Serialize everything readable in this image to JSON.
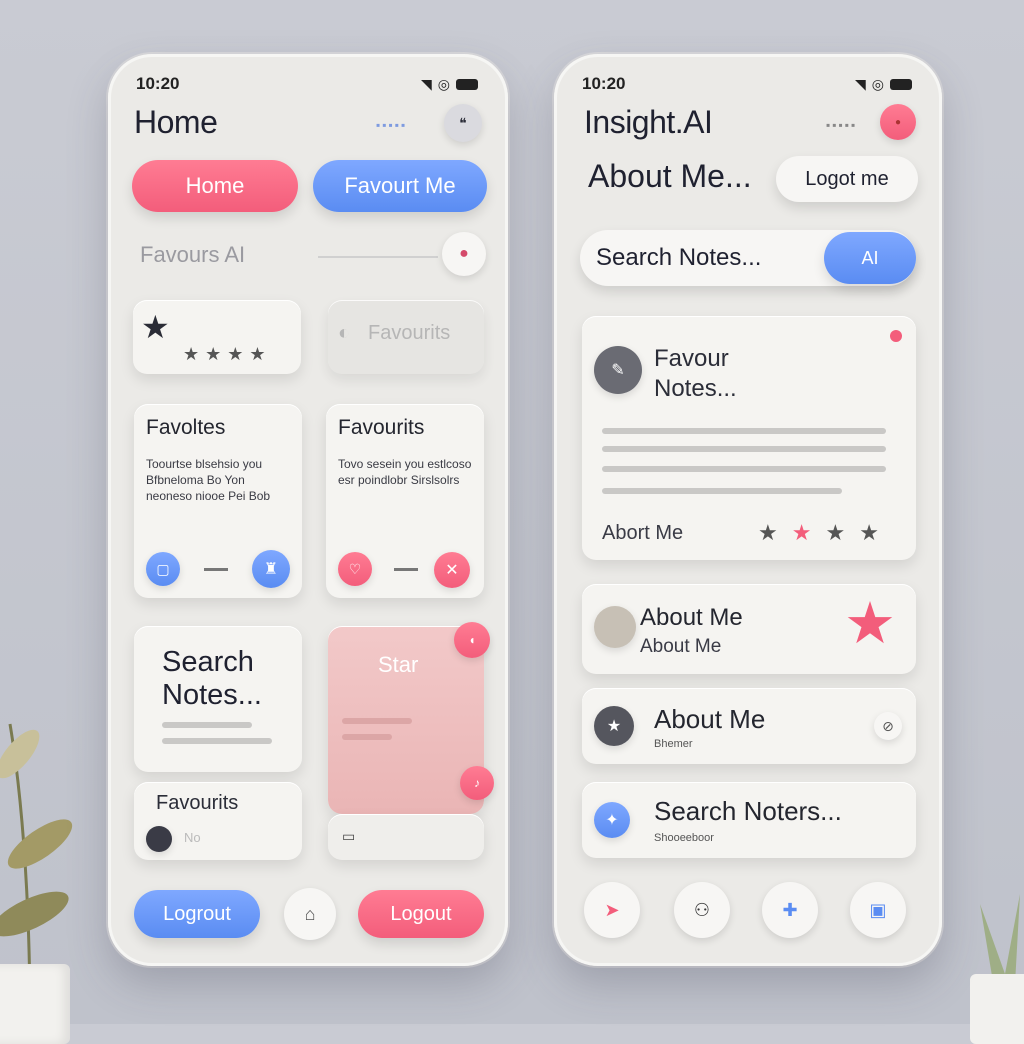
{
  "left_phone": {
    "status_time": "10:20",
    "title": "Home",
    "tabs": {
      "home": "Home",
      "favourite": "Favourt Me"
    },
    "favourites_label": "Favours AI",
    "favourites_chip": "Favourits",
    "cards": [
      {
        "title": "Favoltes",
        "body": "Toourtse blsehsio you Bfbneloma Bo Yon neoneso niooe Pei Bob"
      },
      {
        "title": "Favourits",
        "body": "Tovo sesein you estlcoso esr poindlobr Sirslsolrs"
      }
    ],
    "search_card": {
      "title": "Search Notes..."
    },
    "star_card": {
      "title": "Star"
    },
    "favourits_card": {
      "title": "Favourits",
      "sub": "No"
    },
    "buttons": {
      "logout_blue": "Logrout",
      "logout_pink": "Logout"
    }
  },
  "right_phone": {
    "status_time": "10:20",
    "app_title": "Insight.AI",
    "about_me": "About Me...",
    "logout": "Logot me",
    "search_placeholder": "Search Notes...",
    "search_button": "AI",
    "notes_card": {
      "title": "Favour Notes...",
      "footer": "Abort Me"
    },
    "list_items": [
      {
        "title": "About Me",
        "sub": "About Me"
      },
      {
        "title": "About Me",
        "sub": "Bhemer"
      },
      {
        "title": "Search Noters...",
        "sub": "Shooeeboor"
      }
    ]
  },
  "colors": {
    "pink": "#f35d7b",
    "blue": "#5a8cf2",
    "background": "#c5c7cf"
  }
}
